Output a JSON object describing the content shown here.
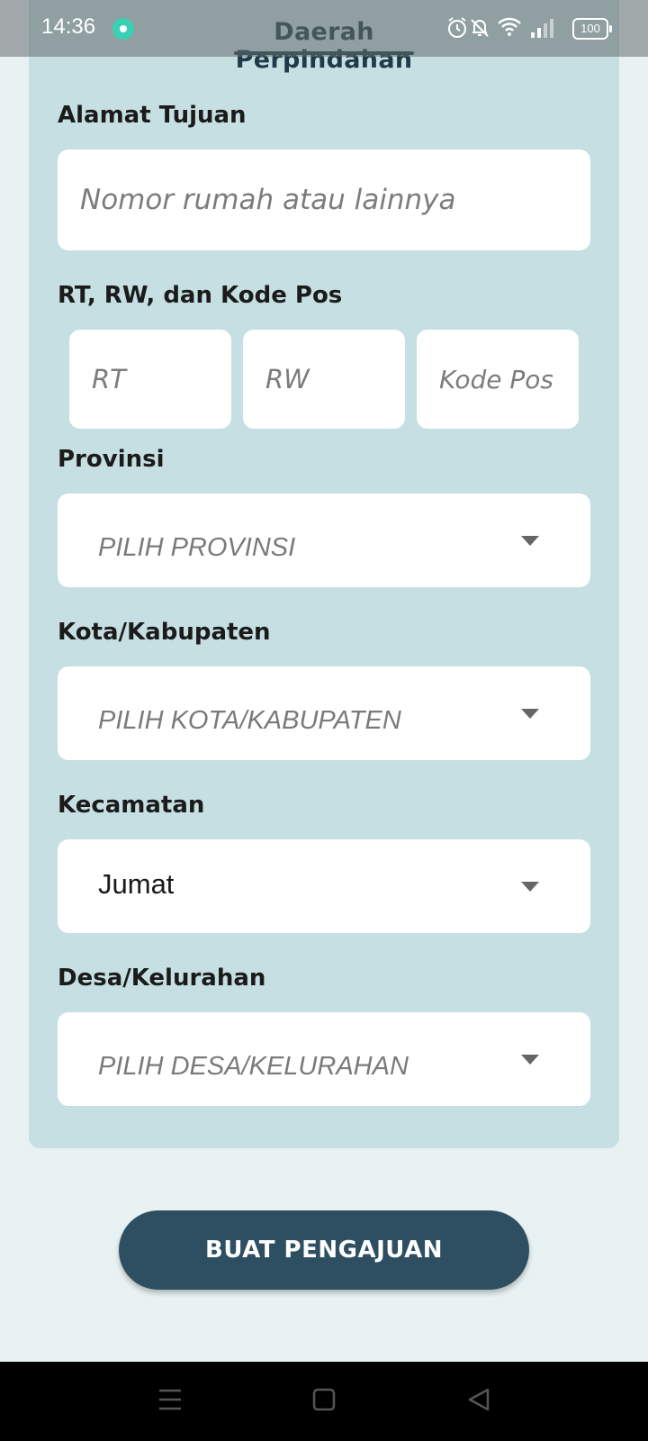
{
  "status_bar": {
    "time": "14:36",
    "battery": "100",
    "icons": [
      "app-notification-icon",
      "alarm-icon",
      "mute-icon",
      "wifi-icon",
      "signal-icon",
      "battery-icon"
    ]
  },
  "header": {
    "title": "Daerah Perpindahan"
  },
  "form": {
    "address": {
      "label": "Alamat Tujuan",
      "placeholder": "Nomor rumah atau lainnya"
    },
    "rt_rw_postal": {
      "label": "RT, RW, dan Kode Pos",
      "rt_placeholder": "RT",
      "rw_placeholder": "RW",
      "postal_placeholder": "Kode Pos"
    },
    "province": {
      "label": "Provinsi",
      "value": "PILIH PROVINSI"
    },
    "city": {
      "label": "Kota/Kabupaten",
      "value": "PILIH KOTA/KABUPATEN"
    },
    "district": {
      "label": "Kecamatan",
      "value": "Jumat"
    },
    "village": {
      "label": "Desa/Kelurahan",
      "value": "PILIH DESA/KELURAHAN"
    }
  },
  "submit_label": "BUAT PENGAJUAN",
  "nav_bar": {
    "icons": [
      "menu-icon",
      "home-icon",
      "back-icon"
    ]
  },
  "colors": {
    "background": "#e9f2f3",
    "card": "#c5dfe2",
    "button": "#2d4f61",
    "header_text": "#1f3a48"
  }
}
